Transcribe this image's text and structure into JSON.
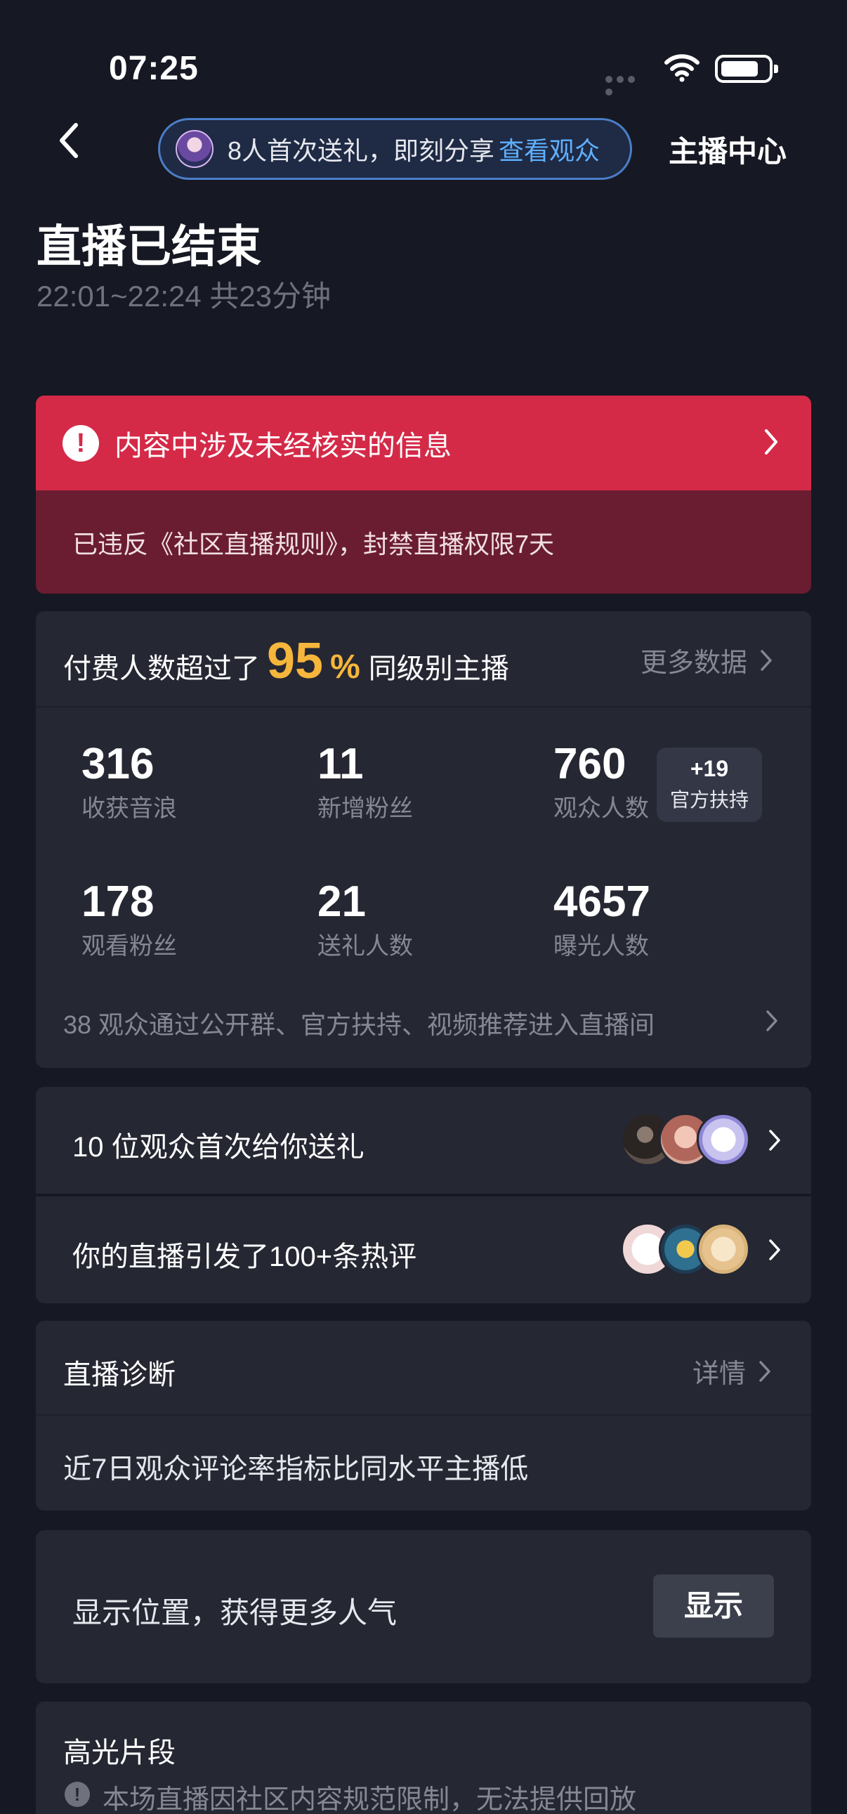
{
  "status_bar": {
    "time": "07:25"
  },
  "header": {
    "notice_text": "8人首次送礼，即刻分享",
    "notice_link": "查看观众",
    "anchor_center": "主播中心"
  },
  "live": {
    "title": "直播已结束",
    "time_range": "22:01~22:24 共23分钟"
  },
  "violation": {
    "title": "内容中涉及未经核实的信息",
    "description": "已违反《社区直播规则》，封禁直播权限7天",
    "colors": {
      "top": "#d42a48",
      "bottom": "#6a1d30"
    }
  },
  "data": {
    "headline_prefix": "付费人数超过了",
    "percent": "95",
    "percent_sign": "%",
    "headline_suffix": "同级别主播",
    "more_link": "更多数据",
    "stats": [
      {
        "value": "316",
        "label": "收获音浪"
      },
      {
        "value": "11",
        "label": "新增粉丝"
      },
      {
        "value": "760",
        "label": "观众人数"
      },
      {
        "value": "178",
        "label": "观看粉丝"
      },
      {
        "value": "21",
        "label": "送礼人数"
      },
      {
        "value": "4657",
        "label": "曝光人数"
      }
    ],
    "badge": {
      "value": "+19",
      "label": "官方扶持"
    },
    "entry_note": "38 观众通过公开群、官方扶持、视频推荐进入直播间",
    "accent_color": "#f5b63b"
  },
  "gifts_row": {
    "text": "10 位观众首次给你送礼"
  },
  "comments_row": {
    "text": "你的直播引发了100+条热评"
  },
  "diagnosis": {
    "title": "直播诊断",
    "detail_link": "详情",
    "body": "近7日观众评论率指标比同水平主播低"
  },
  "location": {
    "text": "显示位置，获得更多人气",
    "button": "显示"
  },
  "highlights": {
    "title": "高光片段",
    "note": "本场直播因社区内容规范限制，无法提供回放"
  }
}
